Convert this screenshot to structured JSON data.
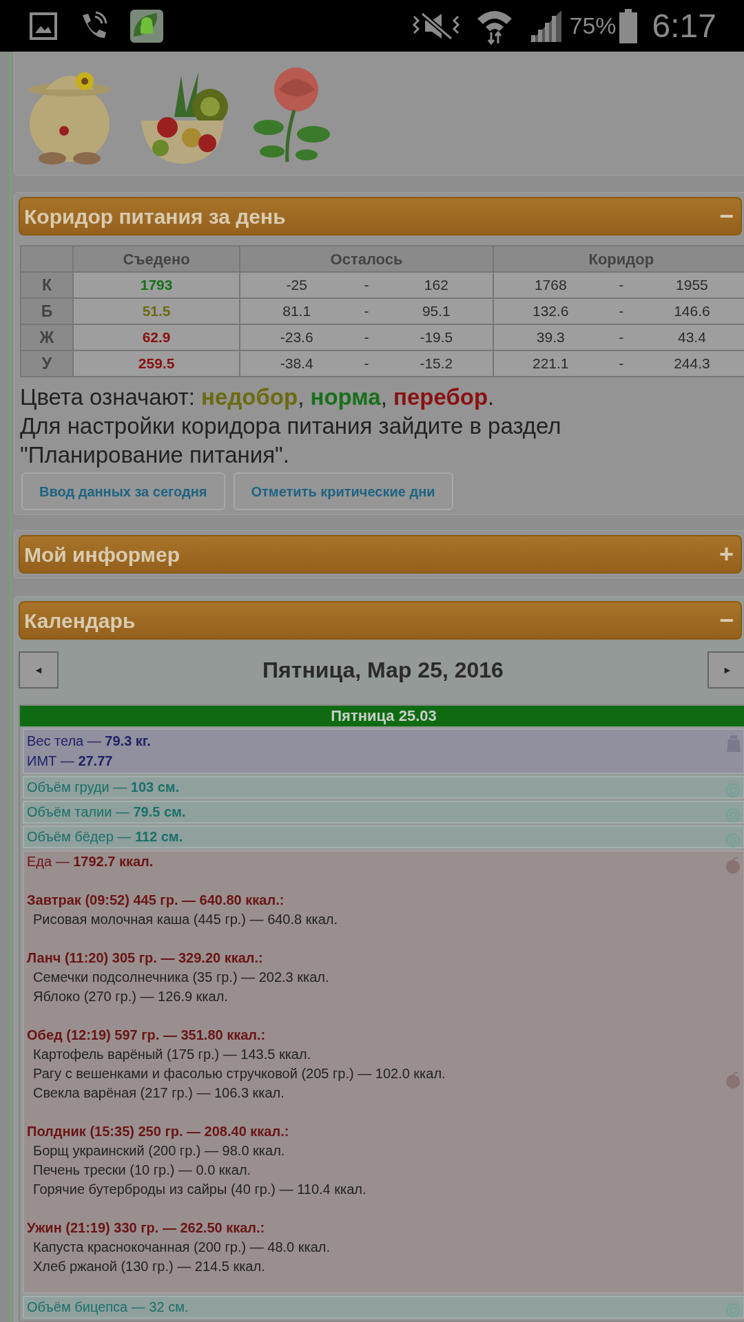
{
  "status_bar": {
    "battery": "75%",
    "time": "6:17"
  },
  "gallery": [
    {
      "kind": "figure"
    },
    {
      "kind": "fruit"
    },
    {
      "kind": "rose"
    }
  ],
  "corridor": {
    "title": "Коридор питания за день",
    "toggle": "−",
    "columns": [
      "Съедено",
      "Осталось",
      "Коридор"
    ],
    "rows": [
      {
        "label": "К",
        "eaten": "1793",
        "color": "#17701a",
        "remaining": [
          "-25",
          "-",
          "162"
        ],
        "range": [
          "1768",
          "-",
          "1955"
        ]
      },
      {
        "label": "Б",
        "eaten": "51.5",
        "color": "#6b6a10",
        "remaining": [
          "81.1",
          "-",
          "95.1"
        ],
        "range": [
          "132.6",
          "-",
          "146.6"
        ]
      },
      {
        "label": "Ж",
        "eaten": "62.9",
        "color": "#8a1010",
        "remaining": [
          "-23.6",
          "-",
          "-19.5"
        ],
        "range": [
          "39.3",
          "-",
          "43.4"
        ]
      },
      {
        "label": "У",
        "eaten": "259.5",
        "color": "#8a1010",
        "remaining": [
          "-38.4",
          "-",
          "-15.2"
        ],
        "range": [
          "221.1",
          "-",
          "244.3"
        ]
      }
    ],
    "legend": [
      {
        "text": "Цвета означают: "
      },
      {
        "text": "недобор",
        "color": "#6b6a10"
      },
      {
        "text": ", "
      },
      {
        "text": "норма",
        "color": "#17701a"
      },
      {
        "text": ", "
      },
      {
        "text": "перебор",
        "color": "#8a1010"
      },
      {
        "text": "."
      }
    ],
    "note": "Для настройки коридора питания зайдите в раздел \"Планирование питания\".",
    "buttons": [
      "Ввод данных за сегодня",
      "Отметить критические дни"
    ]
  },
  "informer": {
    "title": "Мой информер",
    "toggle": "+"
  },
  "calendar": {
    "title": "Календарь",
    "toggle": "−",
    "prev": "◄",
    "next": "►",
    "date": "Пятница, Мар 25, 2016",
    "day_header": "Пятница 25.03",
    "entries": [
      {
        "kind": "weight",
        "lines": [
          "Вес тела — **79.3 кг.**",
          "ИМТ — **27.77**"
        ]
      },
      {
        "kind": "measure",
        "lines": [
          "Объём груди — **103 см.**"
        ]
      },
      {
        "kind": "measure",
        "lines": [
          "Объём талии — **79.5 см.**"
        ]
      },
      {
        "kind": "measure",
        "lines": [
          "Объём бёдер — **112 см.**"
        ]
      },
      {
        "kind": "food",
        "lines": [
          "Еда — **1792.7 ккал.**"
        ],
        "meals": [
          {
            "title": "Завтрак (09:52) 445 гр. — 640.80 ккал.:",
            "items": [
              "Рисовая молочная каша (445 гр.) — 640.8 ккал."
            ]
          },
          {
            "title": "Ланч (11:20) 305 гр. — 329.20 ккал.:",
            "items": [
              "Семечки подсолнечника (35 гр.) — 202.3 ккал.",
              "Яблоко (270 гр.) — 126.9 ккал."
            ]
          },
          {
            "title": "Обед (12:19) 597 гр. — 351.80 ккал.:",
            "items": [
              "Картофель варёный (175 гр.) — 143.5 ккал.",
              "Рагу с вешенками и фасолью стручковой (205 гр.) — 102.0 ккал.",
              "Свекла варёная (217 гр.) — 106.3 ккал."
            ]
          },
          {
            "title": "Полдник (15:35) 250 гр. — 208.40 ккал.:",
            "items": [
              "Борщ украинский (200 гр.) — 98.0 ккал.",
              "Печень трески (10 гр.) — 0.0 ккал.",
              "Горячие бутерброды из сайры (40 гр.) — 110.4 ккал."
            ]
          },
          {
            "title": "Ужин (21:19) 330 гр. — 262.50 ккал.:",
            "items": [
              "Капуста краснокочанная (200 гр.) — 48.0 ккал.",
              "Хлеб ржаной (130 гр.) — 214.5 ккал."
            ]
          }
        ]
      },
      {
        "kind": "measure",
        "lines": [
          "Объём бицепса — 32 см."
        ]
      }
    ]
  }
}
